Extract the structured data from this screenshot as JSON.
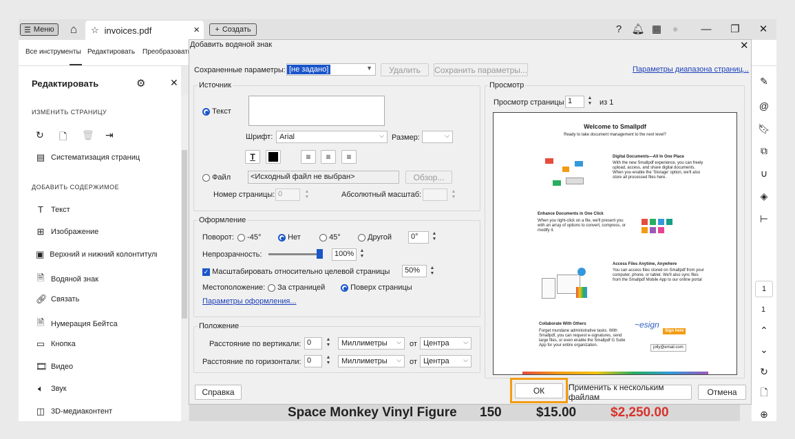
{
  "topbar": {
    "menu": "Меню",
    "tab_title": "invoices.pdf",
    "create": "Создать"
  },
  "toolbar": {
    "all_tools": "Все инструменты",
    "edit": "Редактировать",
    "convert": "Преобразовать"
  },
  "left": {
    "title": "Редактировать",
    "sec1": "ИЗМЕНИТЬ СТРАНИЦУ",
    "organize": "Систематизация страниц",
    "sec2": "ДОБАВИТЬ СОДЕРЖИМОЕ",
    "items": [
      "Текст",
      "Изображение",
      "Верхний и нижний колонтитулы",
      "Водяной знак",
      "Связать",
      "Нумерация Бейтса",
      "Кнопка",
      "Видео",
      "Звук",
      "3D-медиаконтент"
    ]
  },
  "dialog": {
    "title": "Добавить водяной знак",
    "saved_label": "Сохраненные параметры:",
    "saved_value": "[не задано]",
    "delete": "Удалить",
    "save_params": "Сохранить параметры...",
    "range_link": "Параметры диапазона страниц...",
    "source": {
      "title": "Источник",
      "text": "Текст",
      "font_label": "Шрифт:",
      "font": "Arial",
      "size_label": "Размер:",
      "file": "Файл",
      "file_value": "<Исходный файл не выбран>",
      "browse": "Обзор...",
      "page_num": "Номер страницы:",
      "page_num_value": "0",
      "abs_scale": "Абсолютный масштаб:"
    },
    "appearance": {
      "title": "Оформление",
      "rotation": "Поворот:",
      "r1": "-45°",
      "r2": "Нет",
      "r3": "45°",
      "r4": "Другой",
      "rot_value": "0°",
      "opacity": "Непрозрачность:",
      "opacity_value": "100%",
      "opacity_level": 1.0,
      "scale_label": "Масштабировать относительно целевой страницы",
      "scale_value": "50%",
      "location": "Местоположение:",
      "behind": "За страницей",
      "ontop": "Поверх страницы",
      "more": "Параметры оформления..."
    },
    "position": {
      "title": "Положение",
      "vert": "Расстояние по вертикали:",
      "horiz": "Расстояние по горизонтали:",
      "v_value": "0",
      "h_value": "0",
      "unit": "Миллиметры",
      "from": "от",
      "anchor": "Центра"
    },
    "preview": {
      "title": "Просмотр",
      "page_label": "Просмотр страницы",
      "page": "1",
      "of": "из 1"
    },
    "help": "Справка",
    "ok": "ОК",
    "apply_multi": "Применить к нескольким файлам",
    "cancel": "Отмена"
  },
  "preview_doc": {
    "title": "Welcome to Smallpdf",
    "subtitle": "Ready to take document management to the next level?",
    "s1_title": "Digital Documents—All In One Place",
    "s1_body": "With the new Smallpdf experience, you can freely upload, access, and share digital documents. When you enable the 'Storage' option, we'll also store all processed files here.",
    "s2_title": "Enhance Documents in One Click",
    "s2_body": "When you right-click on a file, we'll present you with an array of options to convert, compress, or modify it.",
    "s3_title": "Access Files Anytime, Anywhere",
    "s3_body": "You can access files stored on Smallpdf from your computer, phone, or tablet. We'll also sync files from the Smallpdf Mobile App to our online portal",
    "s4_title": "Collaborate With Others",
    "s4_body": "Forget mundane administrative tasks. With Smallpdf, you can request e-signatures, send large files, or even enable the Smallpdf G Suite App for your entire organization.",
    "sign_here": "Sign here",
    "email": "jolly@email.com"
  },
  "bg_row": {
    "item": "Space Monkey Vinyl Figure",
    "qty": "150",
    "price": "$15.00",
    "total": "$2,250.00"
  },
  "right_rail": {
    "page": "1",
    "page2": "1"
  },
  "colors": {
    "accent": "#f39c12",
    "link": "#1a3fb8",
    "total_red": "#d9322b"
  }
}
